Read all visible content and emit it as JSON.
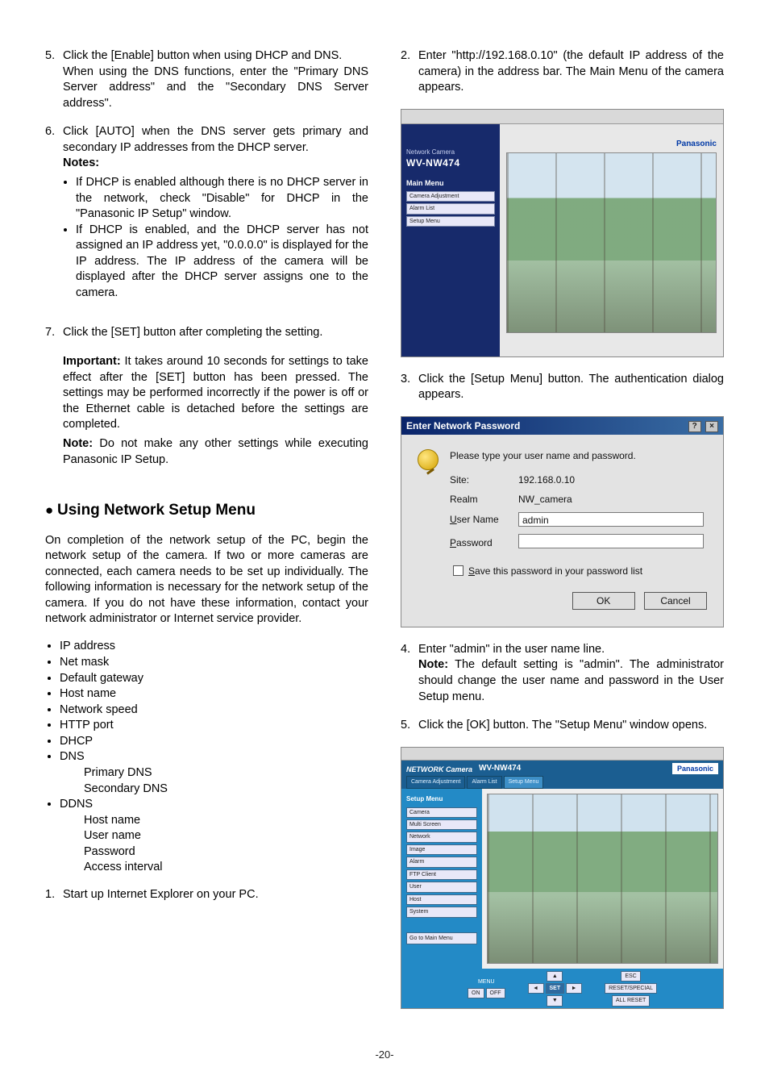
{
  "left": {
    "item5_num": "5.",
    "item5a": "Click the [Enable] button when using DHCP and DNS.",
    "item5b": "When using the DNS functions, enter the \"Primary DNS Server address\" and the \"Secondary DNS Server address\".",
    "item6_num": "6.",
    "item6": "Click [AUTO] when the DNS server gets primary and secondary IP addresses from the DHCP server.",
    "notes_label": "Notes:",
    "note_a": "If DHCP is enabled although there is no DHCP server in the network, check \"Disable\" for DHCP in the \"Panasonic IP Setup\" window.",
    "note_b": "If DHCP is enabled, and the DHCP server has not assigned an IP address yet, \"0.0.0.0\" is displayed for the IP address. The IP address of the camera will be displayed after the DHCP server assigns one to the camera.",
    "item7_num": "7.",
    "item7": "Click the [SET] button after completing the setting.",
    "important_label": "Important:",
    "important_text": " It takes around 10 seconds for settings to take effect after the [SET] button has been pressed. The settings may be performed incorrectly if the power is off or the Ethernet cable is detached before the settings are completed.",
    "note2_label": "Note:",
    "note2_text": " Do not make any other settings while executing Panasonic IP Setup.",
    "section_heading": "Using Network Setup Menu",
    "section_intro": "On completion of the network setup of the PC, begin the network setup of the camera. If two or more cameras are connected, each camera needs to be set up individually. The following information is necessary for the network setup of the camera. If you do not have these information, contact your network administrator or Internet service provider.",
    "bullets": {
      "ip": "IP address",
      "netmask": "Net mask",
      "gateway": "Default gateway",
      "host": "Host name",
      "speed": "Network speed",
      "http": "HTTP port",
      "dhcp": "DHCP",
      "dns": "DNS",
      "dns_primary": "Primary DNS",
      "dns_secondary": "Secondary DNS",
      "ddns": "DDNS",
      "ddns_host": "Host name",
      "ddns_user": "User name",
      "ddns_pass": "Password",
      "ddns_interval": "Access interval"
    },
    "item1_num": "1.",
    "item1": "Start up Internet Explorer on your PC."
  },
  "right": {
    "item2_num": "2.",
    "item2": "Enter \"http://192.168.0.10\" (the default IP address of the camera) in the address bar. The Main Menu of the camera appears.",
    "item3_num": "3.",
    "item3": "Click the [Setup Menu] button. The authentication dialog appears.",
    "item4_num": "4.",
    "item4": "Enter \"admin\" in the user name line.",
    "item4_note_label": "Note:",
    "item4_note": " The default setting is \"admin\". The administrator should change the user name and password in the User Setup menu.",
    "item5_num": "5.",
    "item5": "Click the [OK] button. The \"Setup Menu\" window opens."
  },
  "shot_main": {
    "small": "Network Camera",
    "model": "WV-NW474",
    "menu_label": "Main Menu",
    "buttons": [
      "Camera Adjustment",
      "Alarm List",
      "Setup Menu"
    ],
    "brand": "Panasonic"
  },
  "shot_dialog": {
    "title": "Enter Network Password",
    "prompt": "Please type your user name and password.",
    "site_label": "Site:",
    "site_value": "192.168.0.10",
    "realm_label": "Realm",
    "realm_value": "NW_camera",
    "user_label_pre": "U",
    "user_label_key": "s",
    "user_label_post": "er Name",
    "user_value": "admin",
    "pass_label_pre": "",
    "pass_label_key": "P",
    "pass_label_post": "assword",
    "save_key": "S",
    "save_rest": "ave this password in your password list",
    "ok": "OK",
    "cancel": "Cancel"
  },
  "shot_setup": {
    "logo": "NETWORK Camera",
    "model": "WV-NW474",
    "tabs": [
      "Camera Adjustment",
      "Alarm List",
      "Setup Menu"
    ],
    "brand": "Panasonic",
    "side_header": "Setup Menu",
    "side_buttons": [
      "Camera",
      "Multi Screen",
      "Network",
      "Image",
      "Alarm",
      "FTP Client",
      "User",
      "Host",
      "System"
    ],
    "side_main": "Go to Main Menu",
    "ctrl": {
      "menu_label": "MENU",
      "on": "ON",
      "off": "OFF",
      "left": "◄",
      "set": "SET",
      "right": "►",
      "up": "▲",
      "down": "▼",
      "esc": "ESC",
      "reset": "RESET/SPECIAL",
      "allreset": "ALL RESET"
    }
  },
  "page_number": "-20-"
}
